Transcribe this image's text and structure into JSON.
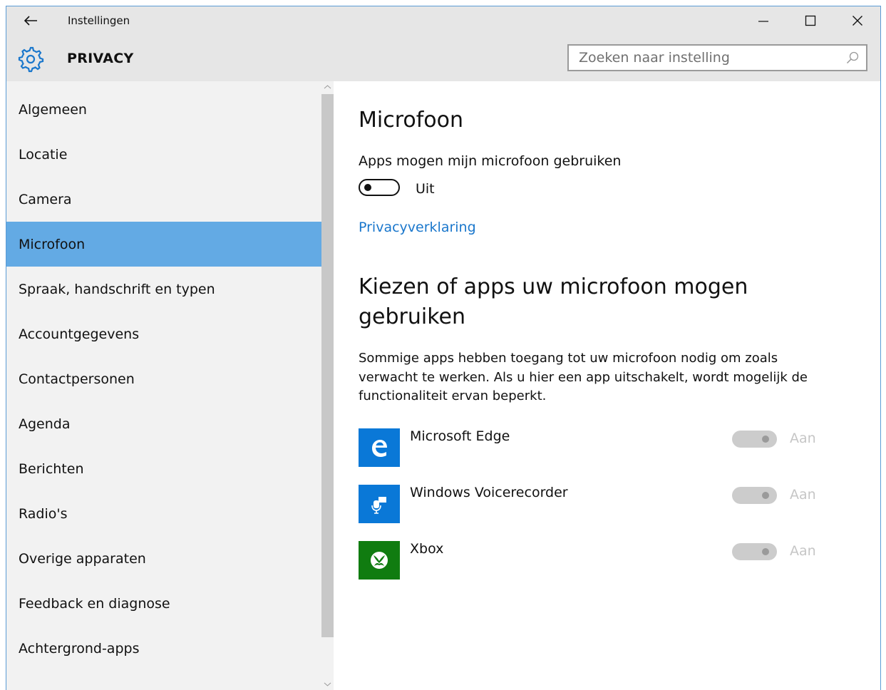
{
  "window": {
    "title": "Instellingen"
  },
  "header": {
    "title": "PRIVACY",
    "icon": "gear-icon",
    "search": {
      "placeholder": "Zoeken naar instelling",
      "value": ""
    }
  },
  "sidebar": {
    "items": [
      {
        "label": "Algemeen"
      },
      {
        "label": "Locatie"
      },
      {
        "label": "Camera"
      },
      {
        "label": "Microfoon",
        "selected": true
      },
      {
        "label": "Spraak, handschrift en typen"
      },
      {
        "label": "Accountgegevens"
      },
      {
        "label": "Contactpersonen"
      },
      {
        "label": "Agenda"
      },
      {
        "label": "Berichten"
      },
      {
        "label": "Radio's"
      },
      {
        "label": "Overige apparaten"
      },
      {
        "label": "Feedback en diagnose"
      },
      {
        "label": "Achtergrond-apps"
      }
    ]
  },
  "main": {
    "title": "Microfoon",
    "setting_label": "Apps mogen mijn microfoon gebruiken",
    "toggle_state": "Uit",
    "privacy_link": "Privacyverklaring",
    "section_title": "Kiezen of apps uw microfoon mogen gebruiken",
    "description": "Sommige apps hebben toegang tot uw microfoon nodig om zoals verwacht te werken. Als u hier een app uitschakelt, wordt mogelijk de functionaliteit ervan beperkt.",
    "apps": [
      {
        "name": "Microsoft Edge",
        "state": "Aan",
        "icon": "edge-icon",
        "color": "#0a78d7"
      },
      {
        "name": "Windows Voicerecorder",
        "state": "Aan",
        "icon": "voice-recorder-icon",
        "color": "#0a78d7"
      },
      {
        "name": "Xbox",
        "state": "Aan",
        "icon": "xbox-icon",
        "color": "#107c10"
      }
    ]
  },
  "colors": {
    "accent": "#63aae4",
    "link": "#1a77cc",
    "chrome": "#e6e6e6",
    "sidebar": "#f2f2f2"
  }
}
